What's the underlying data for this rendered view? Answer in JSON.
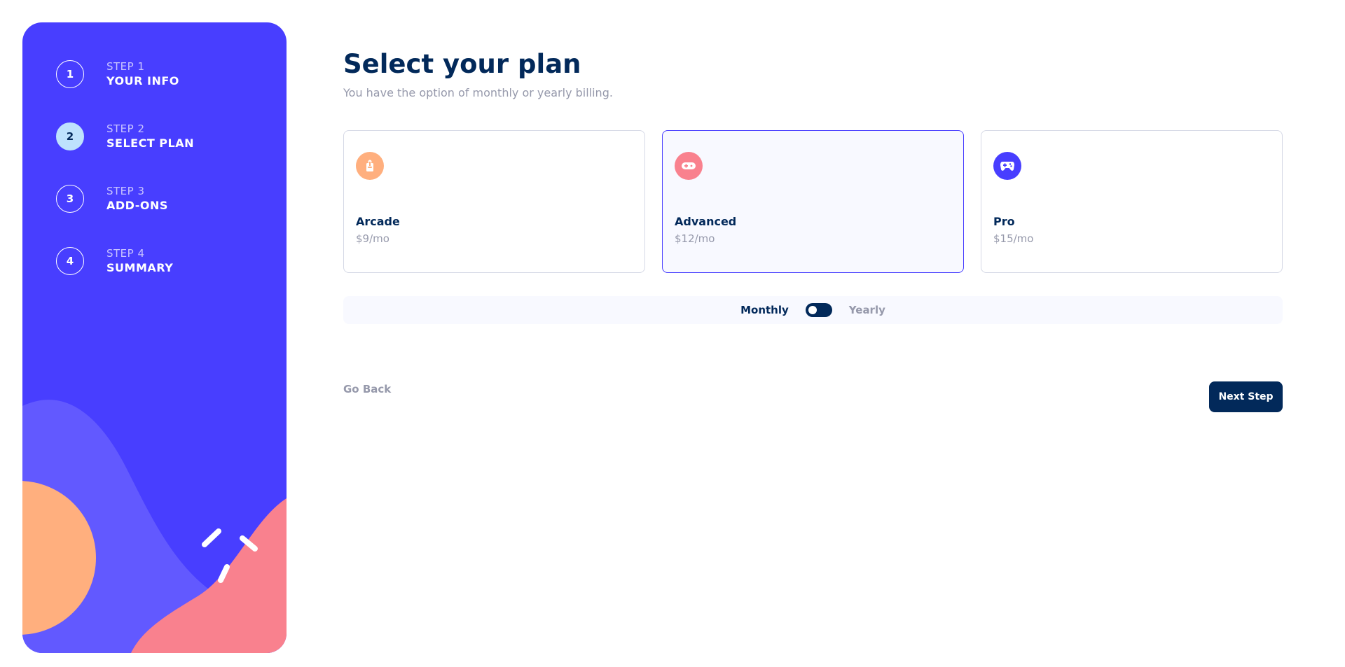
{
  "sidebar": {
    "steps": [
      {
        "number": "1",
        "kicker": "STEP 1",
        "title": "YOUR INFO"
      },
      {
        "number": "2",
        "kicker": "STEP 2",
        "title": "SELECT PLAN"
      },
      {
        "number": "3",
        "kicker": "STEP 3",
        "title": "ADD-ONS"
      },
      {
        "number": "4",
        "kicker": "STEP 4",
        "title": "SUMMARY"
      }
    ]
  },
  "main": {
    "title": "Select your plan",
    "subtitle": "You have the option of monthly or yearly billing.",
    "plans": [
      {
        "name": "Arcade",
        "price": "$9/mo",
        "icon": "arcade-icon",
        "color": "#ffaf7e"
      },
      {
        "name": "Advanced",
        "price": "$12/mo",
        "icon": "gamepad-icon",
        "color": "#f9818e"
      },
      {
        "name": "Pro",
        "price": "$15/mo",
        "icon": "controller-icon",
        "color": "#483eff"
      }
    ],
    "billing": {
      "monthly": "Monthly",
      "yearly": "Yearly"
    },
    "go_back": "Go Back",
    "next_step": "Next Step"
  },
  "colors": {
    "accent": "#483eff",
    "dark": "#02295a",
    "active_step": "#bee2fd",
    "muted": "#9699ab"
  }
}
